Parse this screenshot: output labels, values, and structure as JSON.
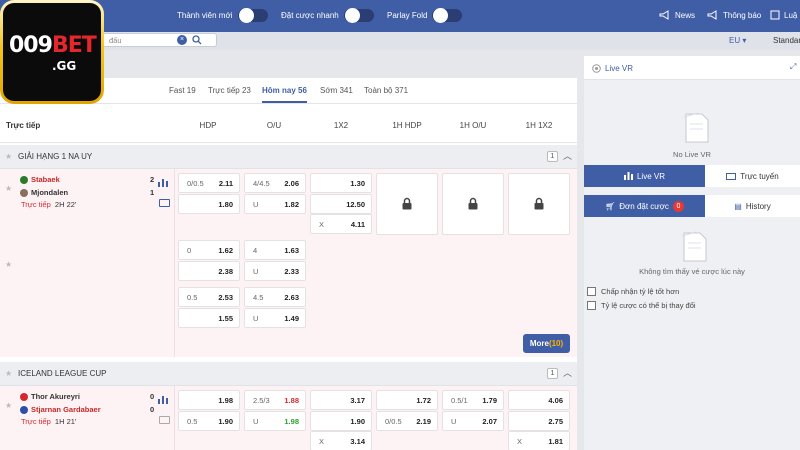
{
  "brand": {
    "logo_main": "009",
    "logo_accent": "BET",
    "logo_sub": ".GG"
  },
  "topbar": {
    "toggles": [
      {
        "label": "Thành viên mới"
      },
      {
        "label": "Đặt cược nhanh"
      },
      {
        "label": "Parlay Fold"
      }
    ],
    "news_label": "News",
    "notify_label": "Thông báo",
    "rules_label": "Luậ",
    "bg_color": "#3f5ea6"
  },
  "search": {
    "placeholder": "đấu"
  },
  "subbar": {
    "odds_type": "EU",
    "view_mode": "Standar"
  },
  "tabs": [
    {
      "label": "Fast 19",
      "active": false
    },
    {
      "label": "Trực tiếp 23",
      "active": false
    },
    {
      "label": "Hôm nay 56",
      "active": true
    },
    {
      "label": "Sớm 341",
      "active": false
    },
    {
      "label": "Toàn bộ 371",
      "active": false
    }
  ],
  "columns": {
    "section_label": "Trực tiếp",
    "headers": [
      "HDP",
      "O/U",
      "1X2",
      "1H HDP",
      "1H O/U",
      "1H 1X2"
    ]
  },
  "leagues": [
    {
      "name": "GIẢI HẠNG 1 NA UY",
      "count": "1",
      "match": {
        "home": "Stabaek",
        "away": "Mjondalen",
        "home_score": "2",
        "away_score": "1",
        "live_label": "Trực tiếp",
        "time": "2H 22'",
        "lines": [
          {
            "hdp": [
              "0/0.5",
              "2.11",
              "",
              "1.80"
            ],
            "ou": [
              "4/4.5",
              "2.06",
              "U",
              "1.82"
            ],
            "x12": [
              "",
              "1.30",
              "",
              "12.50",
              "X",
              "4.11"
            ]
          },
          {
            "hdp": [
              "0",
              "1.62",
              "",
              "2.38"
            ],
            "ou": [
              "4",
              "1.63",
              "U",
              "2.33"
            ]
          },
          {
            "hdp": [
              "0.5",
              "2.53",
              "",
              "1.55"
            ],
            "ou": [
              "4.5",
              "2.63",
              "U",
              "1.49"
            ]
          }
        ],
        "more_label": "More",
        "more_count": "(10)"
      }
    },
    {
      "name": "ICELAND LEAGUE CUP",
      "count": "1",
      "match": {
        "home": "Thor Akureyri",
        "away": "Stjarnan Gardabaer",
        "home_score": "0",
        "away_score": "0",
        "live_label": "Trực tiếp",
        "time": "1H 21'",
        "hdp": [
          "",
          "1.98",
          "0.5",
          "1.90"
        ],
        "ou": [
          "2.5/3",
          "1.88",
          "U",
          "1.98"
        ],
        "x12": [
          "",
          "3.17",
          "",
          "1.90",
          "X",
          "3.14"
        ],
        "h1hdp": [
          "",
          "1.72",
          "0/0.5",
          "2.19"
        ],
        "h1ou": [
          "0.5/1",
          "1.79",
          "U",
          "2.07"
        ],
        "h1x12": [
          "",
          "4.06",
          "",
          "2.75",
          "X",
          "1.81"
        ]
      }
    }
  ],
  "right_panel": {
    "live_vr_title": "Live VR",
    "no_live_text": "No Live VR",
    "tabs": [
      "Live VR",
      "Trực tuyến"
    ],
    "bet_tabs": [
      "Đơn đặt cược",
      "History"
    ],
    "bet_count": "0",
    "empty_bets": "Không tìm thấy vé cược lúc này",
    "options": [
      "Chấp nhận tỷ lệ tốt hơn",
      "Tỷ lệ cược có thể bị thay đổi"
    ]
  }
}
